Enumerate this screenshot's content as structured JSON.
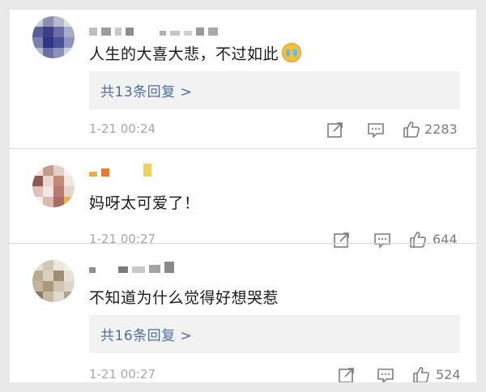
{
  "comments": [
    {
      "text": "人生的大喜大悲，不过如此",
      "emoji": "crying-emoji",
      "replies_label": "共13条回复 >",
      "time": "1-21 00:24",
      "likes": "2283"
    },
    {
      "text": "妈呀太可爱了！",
      "time": "1-21 00:27",
      "likes": "644"
    },
    {
      "text": "不知道为什么觉得好想哭惹",
      "replies_label": "共16条回复 >",
      "time": "1-21 00:27",
      "likes": "524"
    }
  ],
  "icons": {
    "share": "share-icon",
    "comment": "comment-icon",
    "like": "thumbs-up-icon"
  },
  "colors": {
    "link": "#4f6e99",
    "meta_text": "#a8a8a8",
    "reply_box_bg": "#f2f2f2"
  }
}
